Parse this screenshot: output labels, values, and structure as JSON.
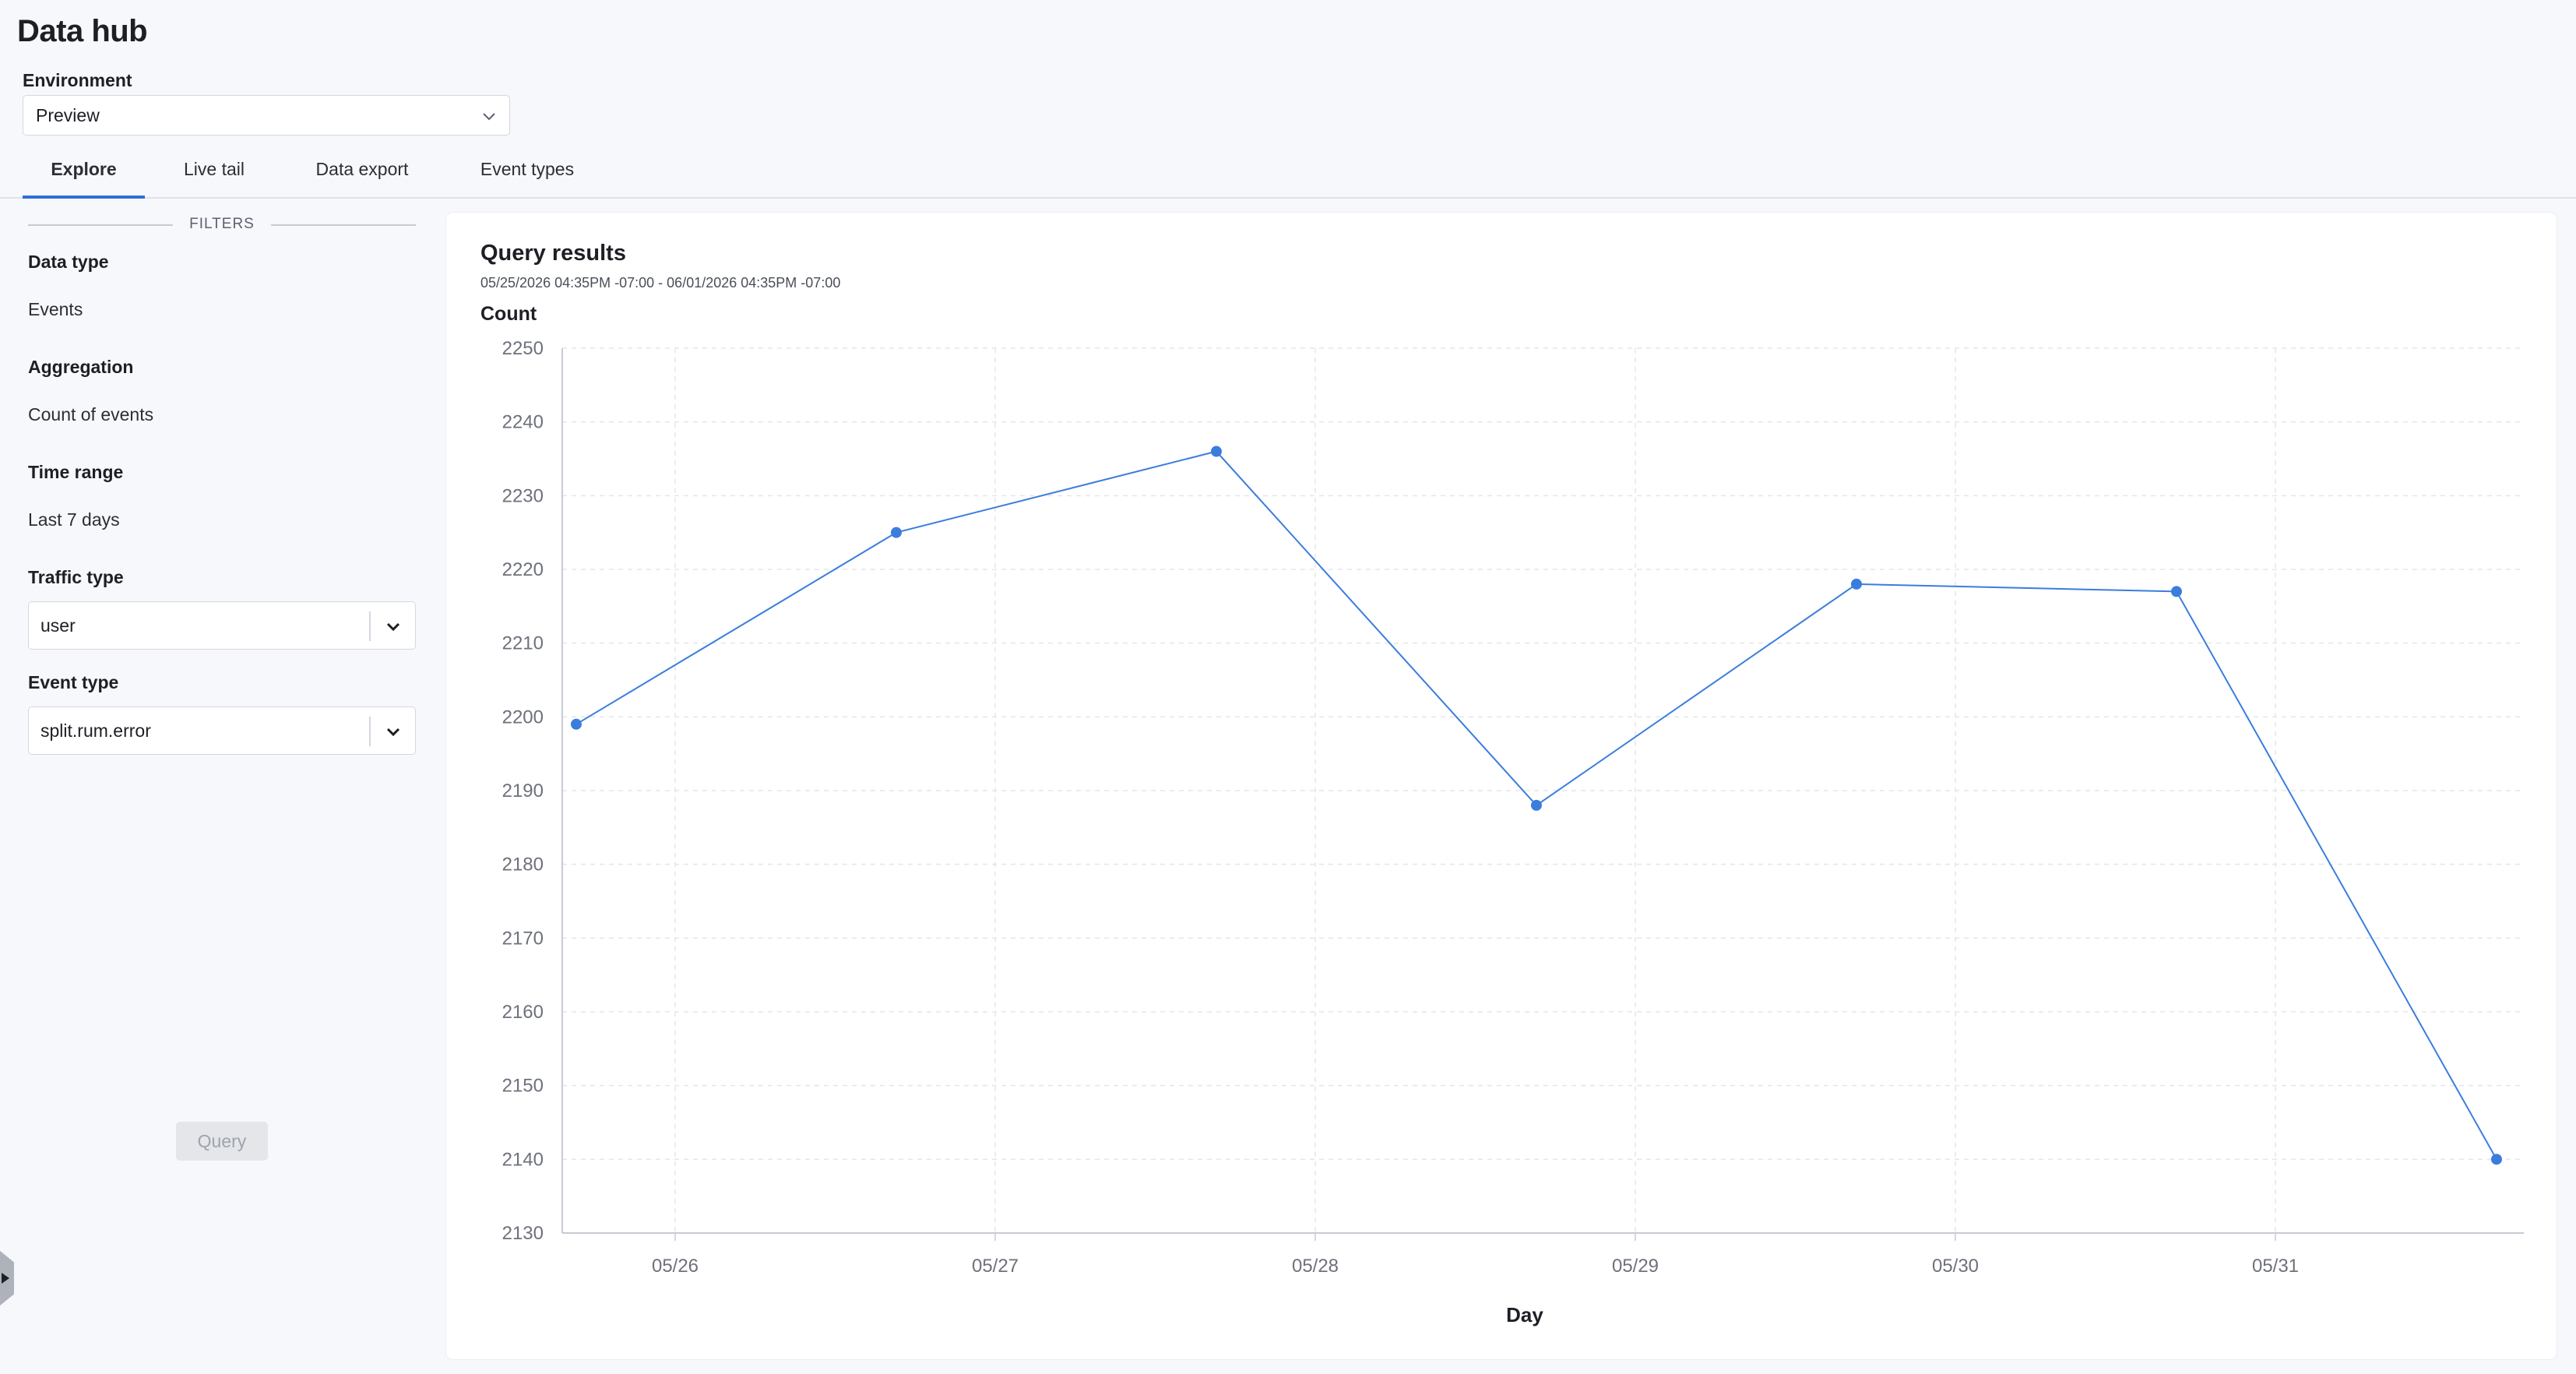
{
  "app": {
    "title": "Data hub"
  },
  "environment": {
    "label": "Environment",
    "selected": "Preview"
  },
  "tabs": [
    {
      "label": "Explore",
      "active": true
    },
    {
      "label": "Live tail",
      "active": false
    },
    {
      "label": "Data export",
      "active": false
    },
    {
      "label": "Event types",
      "active": false
    }
  ],
  "filters": {
    "heading": "FILTERS",
    "data_type": {
      "label": "Data type",
      "value": "Events"
    },
    "aggregation": {
      "label": "Aggregation",
      "value": "Count of events"
    },
    "time_range": {
      "label": "Time range",
      "value": "Last 7 days"
    },
    "traffic_type": {
      "label": "Traffic type",
      "value": "user"
    },
    "event_type": {
      "label": "Event type",
      "value": "split.rum.error"
    },
    "query_button": "Query"
  },
  "results": {
    "title": "Query results",
    "range": "05/25/2026 04:35PM -07:00 - 06/01/2026 04:35PM -07:00"
  },
  "colors": {
    "accent": "#2f6fd6",
    "series": "#3b7ddd"
  },
  "icons": {
    "dropdown": "chevron-down-icon",
    "collapse": "sidebar-toggle-icon"
  },
  "chart_data": {
    "type": "line",
    "title": "Query results",
    "subtitle": "05/25/2026 04:35PM -07:00 - 06/01/2026 04:35PM -07:00",
    "xlabel": "Day",
    "ylabel": "Count",
    "x_ticks": [
      "05/26",
      "05/27",
      "05/28",
      "05/29",
      "05/30",
      "05/31"
    ],
    "y_ticks": [
      2130,
      2140,
      2150,
      2160,
      2170,
      2180,
      2190,
      2200,
      2210,
      2220,
      2230,
      2240,
      2250
    ],
    "ylim": [
      2130,
      2250
    ],
    "grid": true,
    "series": [
      {
        "x": [
          "05/25 16:35",
          "05/26 16:35",
          "05/27 16:35",
          "05/28 16:35",
          "05/29 16:35",
          "05/30 16:35",
          "05/31 16:35"
        ],
        "values": [
          2199,
          2225,
          2236,
          2188,
          2218,
          2217,
          2140
        ]
      }
    ]
  }
}
